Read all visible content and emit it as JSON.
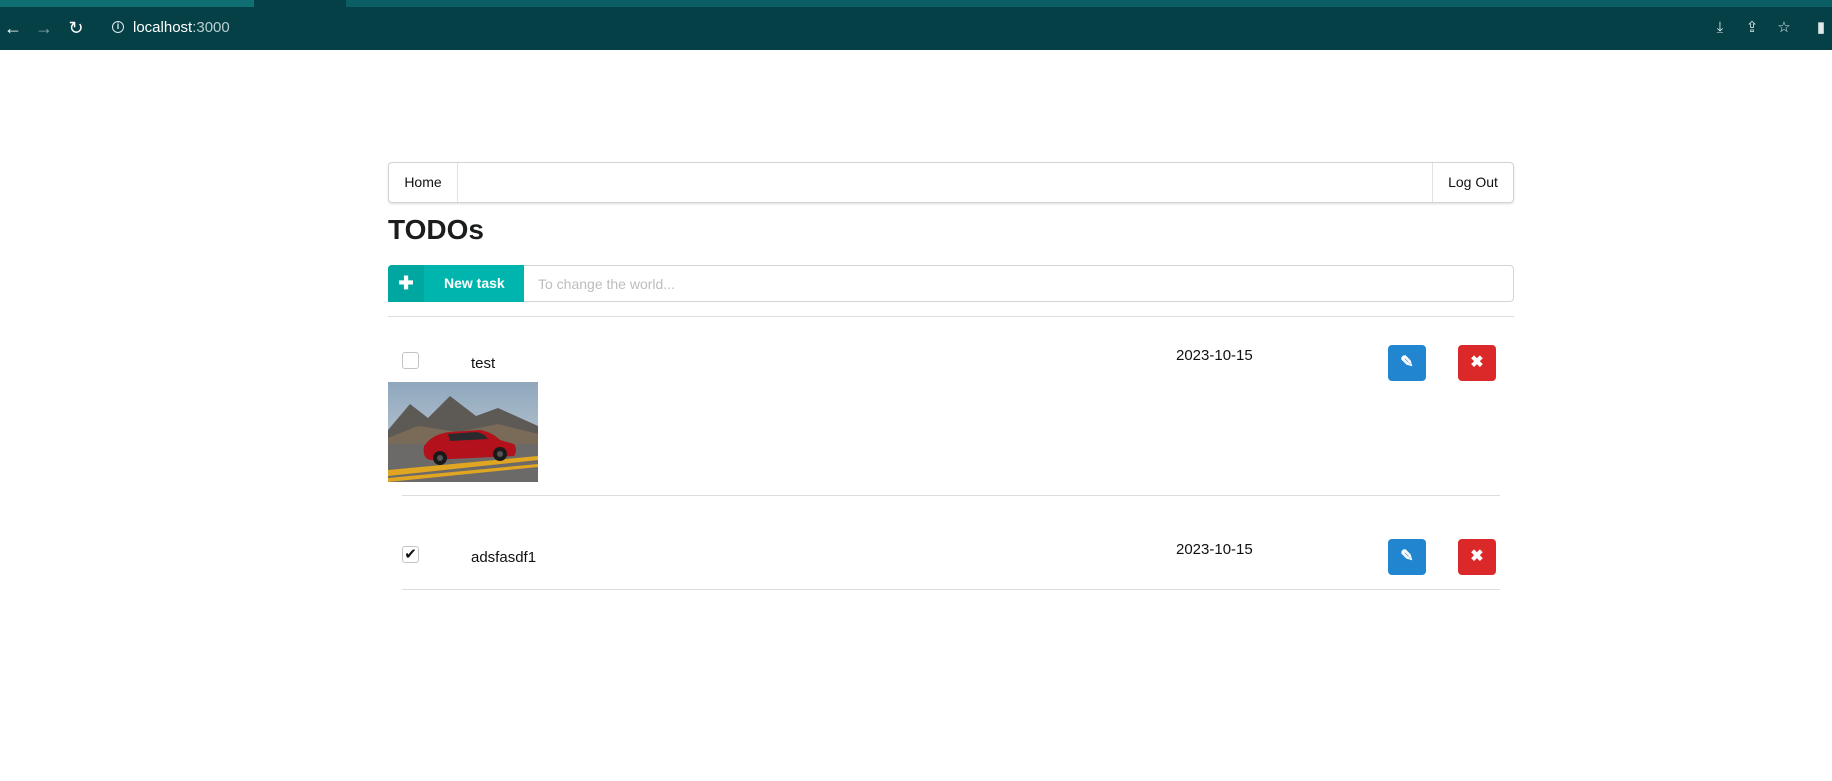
{
  "browser": {
    "url_host": "localhost",
    "url_port": ":3000"
  },
  "nav": {
    "home_label": "Home",
    "logout_label": "Log Out"
  },
  "page": {
    "title": "TODOs"
  },
  "new_task": {
    "button_label": "New task",
    "input_placeholder": "To change the world...",
    "input_value": ""
  },
  "tasks": [
    {
      "name": "test",
      "date": "2023-10-15",
      "checked": false,
      "has_image": true
    },
    {
      "name": "adsfasdf1",
      "date": "2023-10-15",
      "checked": true,
      "has_image": false
    }
  ],
  "colors": {
    "chrome": "#054047",
    "teal": "#00b5ad",
    "edit_blue": "#2185d0",
    "delete_red": "#db2828"
  },
  "icons": {
    "back": "arrow-left-icon",
    "forward": "arrow-right-icon",
    "reload": "reload-icon",
    "info": "info-icon",
    "install": "install-icon",
    "share": "share-icon",
    "bookmark": "star-icon",
    "sidebar": "sidebar-icon",
    "add": "plus-icon",
    "edit": "pencil-icon",
    "delete": "close-icon"
  }
}
